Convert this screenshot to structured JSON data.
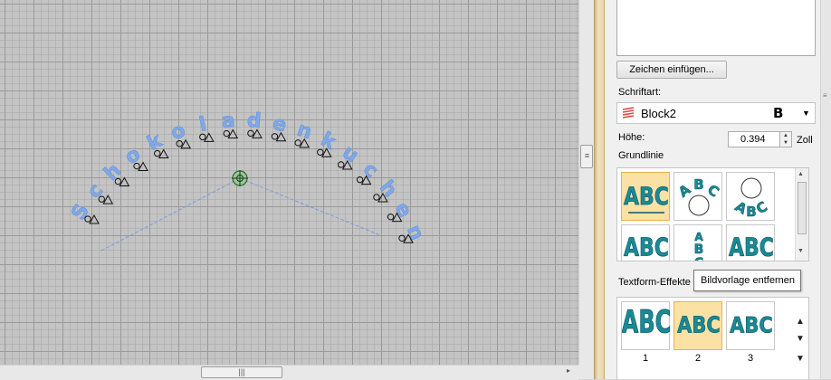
{
  "canvas": {
    "arc_text": "Schokoladenkuchen",
    "text_color": "#7ea8e8",
    "guide_color": "#7a9de0"
  },
  "scrollbars": {
    "grip_glyph": "|||",
    "v_grip_glyph": "≡",
    "right_arrow": "▸"
  },
  "panel": {
    "insert_char_button": "Zeichen einfügen...",
    "font_label": "Schriftart:",
    "font_value": "Block2",
    "font_type_icon": "embroidery-font-icon",
    "font_b_glyph": "B",
    "dropdown_arrow": "▼",
    "height_label": "Höhe:",
    "height_value": "0.394",
    "height_unit": "Zoll",
    "spinner_up": "▲",
    "spinner_down": "▼",
    "baseline_label": "Grundlinie",
    "baseline_tiles": [
      {
        "label": "ABC",
        "style": "straight-underline",
        "selected": true
      },
      {
        "label": "ABC",
        "style": "circle-top",
        "selected": false
      },
      {
        "label": "ABC",
        "style": "circle-bottom",
        "selected": false
      },
      {
        "label": "ABC",
        "style": "straight",
        "selected": false
      },
      {
        "label": "ABC",
        "style": "vertical-stack",
        "selected": false
      },
      {
        "label": "ABC",
        "style": "straight-tall",
        "selected": false
      }
    ],
    "effects_label": "Textform-Effekte",
    "tooltip": "Bildvorlage entfernen",
    "effect_tiles": [
      {
        "label": "ABC",
        "number": "1",
        "style": "bulge",
        "selected": false
      },
      {
        "label": "ABC",
        "number": "2",
        "style": "wave",
        "selected": true
      },
      {
        "label": "ABC",
        "number": "3",
        "style": "arch-up",
        "selected": false
      }
    ],
    "accent_color": "#1a8a96",
    "selected_tile_color": "#fbe1a4"
  }
}
